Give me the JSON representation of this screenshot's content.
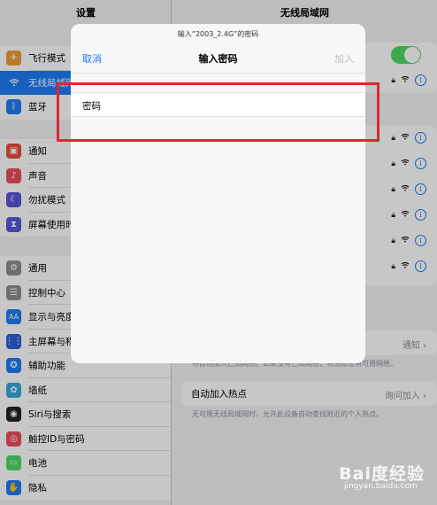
{
  "left_pane": {
    "title": "设置",
    "group1": [
      {
        "label": "飞行模式",
        "icon": "airplane-icon",
        "color": "#f19a37"
      },
      {
        "label": "无线局域网",
        "icon": "wifi-icon",
        "color": "#1e7cf2",
        "selected": true
      },
      {
        "label": "蓝牙",
        "icon": "bluetooth-icon",
        "color": "#1e7cf2"
      }
    ],
    "group2": [
      {
        "label": "通知",
        "icon": "notification-icon",
        "color": "#eb4d3d"
      },
      {
        "label": "声音",
        "icon": "sound-icon",
        "color": "#eb4d5f"
      },
      {
        "label": "勿扰模式",
        "icon": "moon-icon",
        "color": "#5a55d6"
      },
      {
        "label": "屏幕使用时间",
        "icon": "hourglass-icon",
        "color": "#5a55d6"
      }
    ],
    "group3": [
      {
        "label": "通用",
        "icon": "gear-icon",
        "color": "#8e8e93"
      },
      {
        "label": "控制中心",
        "icon": "control-center-icon",
        "color": "#8e8e93"
      },
      {
        "label": "显示与亮度",
        "icon": "display-icon",
        "color": "#1e7cf2"
      },
      {
        "label": "主屏幕与程序坞",
        "icon": "home-screen-icon",
        "color": "#2f5fd6"
      },
      {
        "label": "辅助功能",
        "icon": "accessibility-icon",
        "color": "#1e7cf2"
      },
      {
        "label": "墙纸",
        "icon": "wallpaper-icon",
        "color": "#35aadc"
      },
      {
        "label": "Siri与搜索",
        "icon": "siri-icon",
        "color": "#222222"
      },
      {
        "label": "触控ID与密码",
        "icon": "fingerprint-icon",
        "color": "#eb4d5f"
      },
      {
        "label": "电池",
        "icon": "battery-icon",
        "color": "#4cd964"
      },
      {
        "label": "隐私",
        "icon": "privacy-icon",
        "color": "#1e7cf2"
      }
    ]
  },
  "right_pane": {
    "title": "无线局域网",
    "ask_join_value": "通知",
    "ask_join_desc": "将自动加入已知网络。如果没有已知网络，将通知您有可用网络。",
    "hotspot_label": "自动加入热点",
    "hotspot_value": "询问加入",
    "hotspot_desc": "无可用无线局域网时，允许此设备自动查找附近的个人热点。"
  },
  "modal": {
    "subtitle": "输入“2003_2.4G”的密码",
    "cancel": "取消",
    "title": "输入密码",
    "join": "加入",
    "password_label": "密码",
    "password_value": ""
  },
  "watermark": {
    "brand": "Bai度经验",
    "url": "jingyan.baidu.com"
  }
}
